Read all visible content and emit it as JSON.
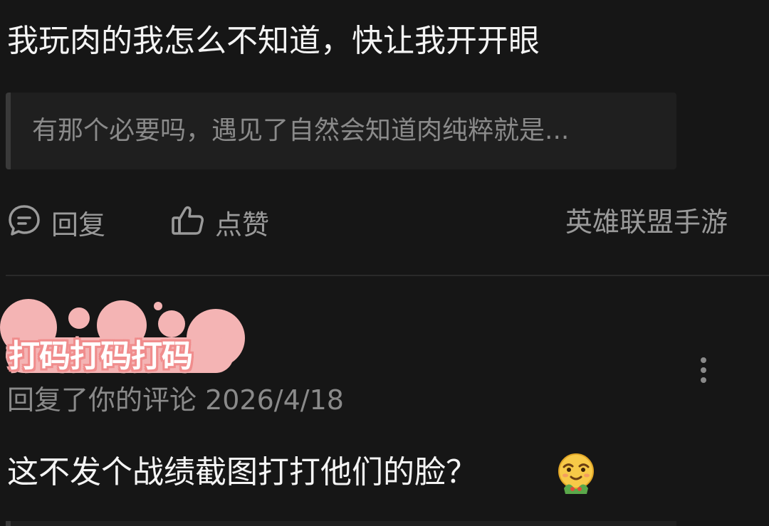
{
  "comment": {
    "text": "我玩肉的我怎么不知道，快让我开开眼",
    "quote": "有那个必要吗，遇见了自然会知道肉纯粹就是..."
  },
  "actions": {
    "reply_label": "回复",
    "like_label": "点赞",
    "game_tag": "英雄联盟手游"
  },
  "reply_item": {
    "masked_name": "打码打码打码",
    "meta": "回复了你的评论 2026/4/18",
    "text": "这不发个战绩截图打打他们的脸？",
    "emoji": "smirk-emoji"
  },
  "colors": {
    "background": "#161616",
    "primary_text": "#f4f4f4",
    "secondary_text": "#8a8a8a",
    "quote_bg": "#1f1f1f",
    "mask_pink": "#f4b4b4"
  }
}
